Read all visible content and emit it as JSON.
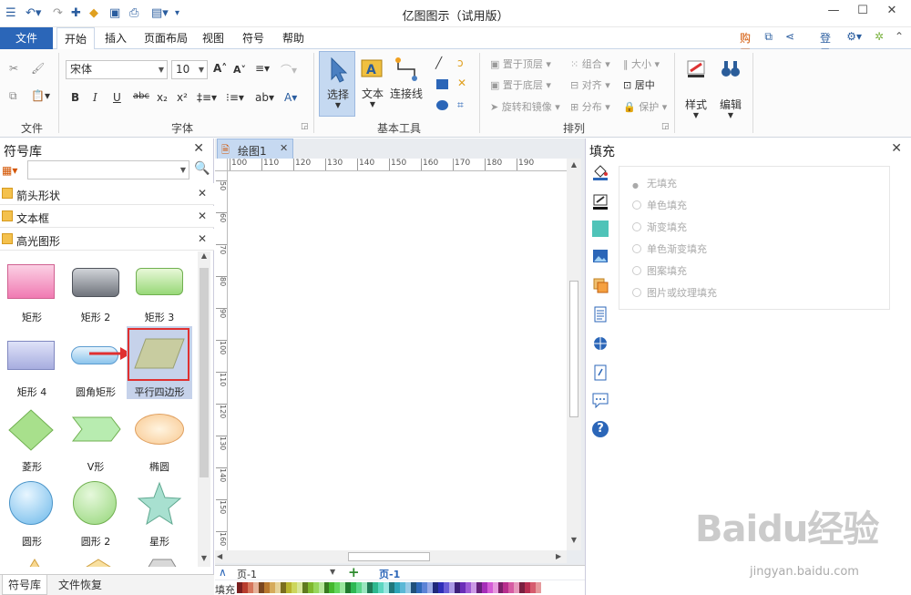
{
  "app": {
    "title": "亿图图示（试用版）"
  },
  "menu": {
    "file": "文件",
    "tabs": [
      "开始",
      "插入",
      "页面布局",
      "视图",
      "符号",
      "帮助"
    ],
    "buy": "购买",
    "login": "登录"
  },
  "ribbon": {
    "groups": {
      "file": "文件",
      "font": "字体",
      "basic_tools": "基本工具",
      "arrange": "排列"
    },
    "font_name": "宋体",
    "font_size": "10",
    "tools": {
      "select": "选择",
      "text": "文本",
      "connector": "连接线"
    },
    "arrange": {
      "bring_front": "置于顶层",
      "send_back": "置于底层",
      "rotate_mirror": "旋转和镜像",
      "group": "组合",
      "align": "对齐",
      "distribute": "分布",
      "size": "大小",
      "center": "居中",
      "protect": "保护"
    },
    "style": "样式",
    "edit": "编辑"
  },
  "library": {
    "title": "符号库",
    "search_placeholder": "",
    "sections": [
      "箭头形状",
      "文本框",
      "高光图形"
    ],
    "shapes": [
      "矩形",
      "矩形 2",
      "矩形 3",
      "矩形 4",
      "圆角矩形",
      "平行四边形",
      "菱形",
      "V形",
      "椭圆",
      "圆形",
      "圆形 2",
      "星形"
    ],
    "bottom_tabs": [
      "符号库",
      "文件恢复"
    ]
  },
  "document": {
    "tab": "绘图1",
    "ruler_h": [
      "100",
      "110",
      "120",
      "130",
      "140",
      "150",
      "160",
      "170",
      "180",
      "190"
    ],
    "ruler_v": [
      "50",
      "60",
      "70",
      "80",
      "90",
      "100",
      "110",
      "120",
      "130",
      "140",
      "150",
      "160"
    ],
    "page_selector": "页-1",
    "page_tab": "页-1",
    "fill_label": "填充"
  },
  "fill_panel": {
    "title": "填充",
    "options": [
      "无填充",
      "单色填充",
      "渐变填充",
      "单色渐变填充",
      "图案填充",
      "图片或纹理填充"
    ]
  },
  "watermark": {
    "text": "Baidu经验",
    "url": "jingyan.baidu.com"
  }
}
